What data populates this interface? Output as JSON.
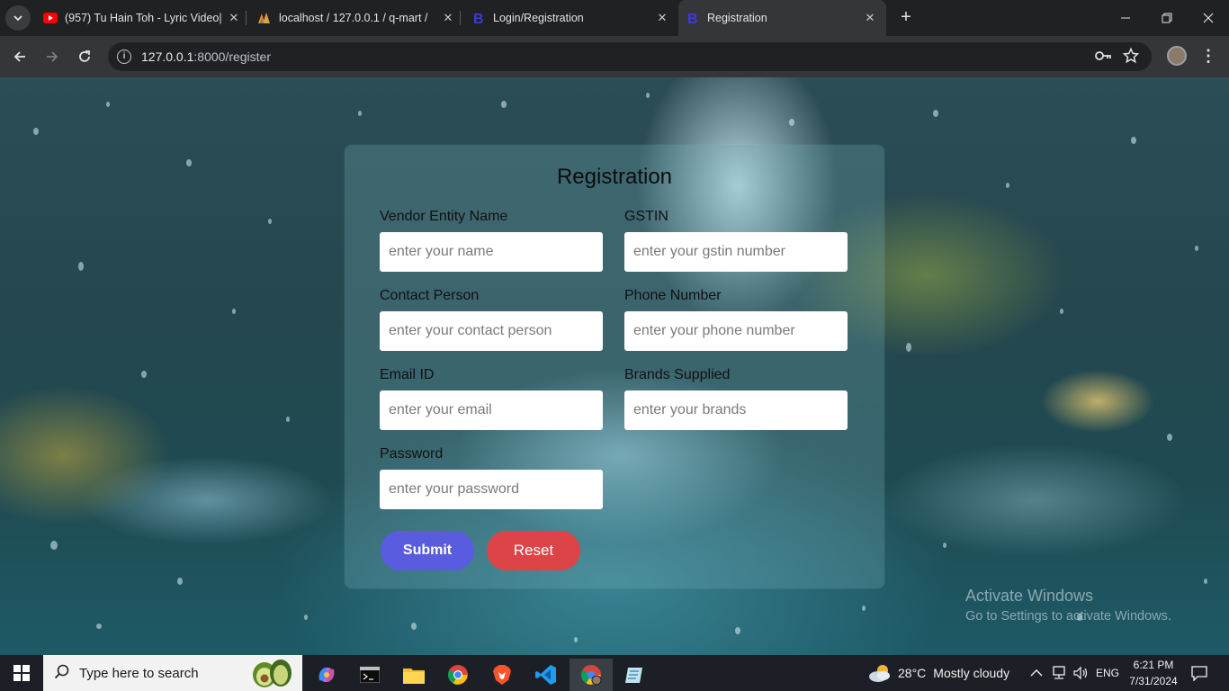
{
  "browser": {
    "tabs": [
      {
        "title": "(957) Tu Hain Toh - Lyric Video|",
        "icon": "youtube-icon"
      },
      {
        "title": "localhost / 127.0.0.1 / q-mart /",
        "icon": "phpmyadmin-icon"
      },
      {
        "title": "Login/Registration",
        "icon": "bootstrap-icon"
      },
      {
        "title": "Registration",
        "icon": "bootstrap-icon",
        "active": true
      }
    ],
    "url_host": "127.0.0.1",
    "url_path": ":8000/register"
  },
  "form": {
    "title": "Registration",
    "fields": [
      {
        "label": "Vendor Entity Name",
        "placeholder": "enter your name"
      },
      {
        "label": "GSTIN",
        "placeholder": "enter your gstin number"
      },
      {
        "label": "Contact Person",
        "placeholder": "enter your contact person"
      },
      {
        "label": "Phone Number",
        "placeholder": "enter your phone number"
      },
      {
        "label": "Email ID",
        "placeholder": "enter your email"
      },
      {
        "label": "Brands Supplied",
        "placeholder": "enter your brands"
      },
      {
        "label": "Password",
        "placeholder": "enter your password"
      }
    ],
    "submit_label": "Submit",
    "reset_label": "Reset",
    "submit_color": "#5a5ce0",
    "reset_color": "#dc4448"
  },
  "watermark": {
    "line1": "Activate Windows",
    "line2": "Go to Settings to activate Windows."
  },
  "taskbar": {
    "search_placeholder": "Type here to search",
    "weather_temp": "28°C",
    "weather_text": "Mostly cloudy",
    "language": "ENG",
    "time": "6:21 PM",
    "date": "7/31/2024"
  }
}
